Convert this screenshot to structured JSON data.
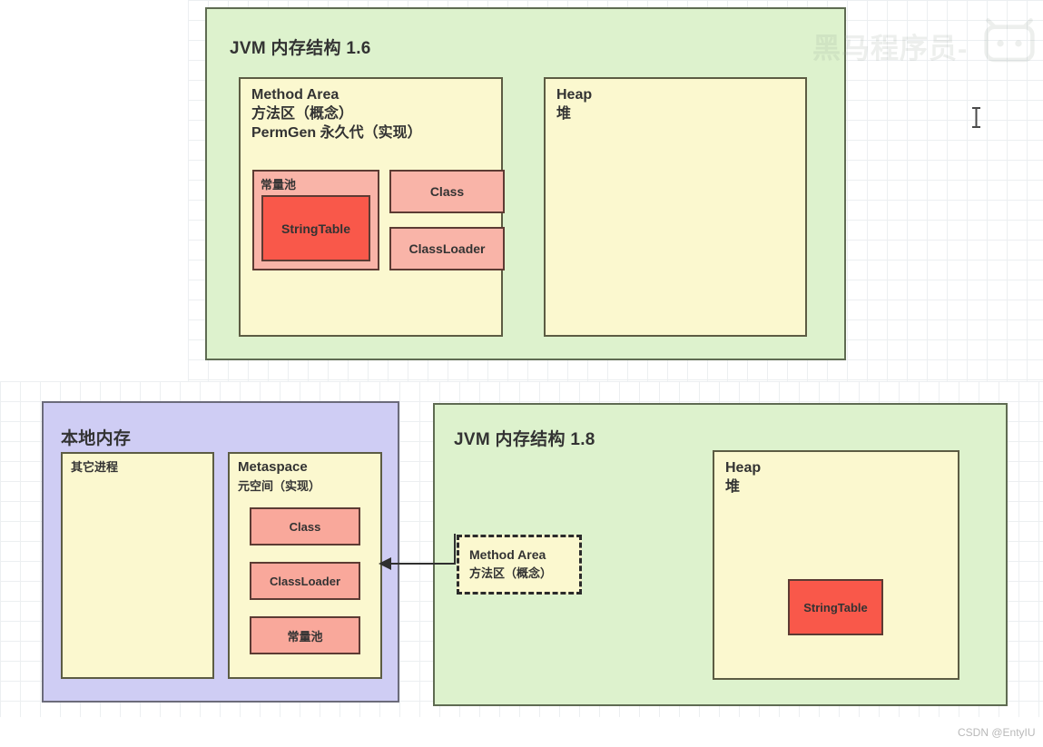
{
  "background": {
    "grid_color": "#eceff1",
    "page_color": "#ffffff"
  },
  "colors": {
    "panel_green": "#ddf2cd",
    "panel_purple": "#cfcdf4",
    "box_yellow": "#fbf8cf",
    "box_salmon": "#f9a89b",
    "box_salmon_light": "#f9b4a8",
    "box_red": "#f9584a",
    "border_dark": "#5c5c43",
    "arrow": "#2f2f2f"
  },
  "jvm16_panel": {
    "title": "JVM 内存结构 1.6",
    "method_area": {
      "line1": "Method Area",
      "line2": "方法区（概念）",
      "line3": "PermGen 永久代（实现）",
      "constant_pool": {
        "label": "常量池",
        "string_table": "StringTable"
      },
      "class_box": "Class",
      "classloader_box": "ClassLoader"
    },
    "heap": {
      "line1": "Heap",
      "line2": "堆"
    }
  },
  "native_memory_panel": {
    "title": "本地内存",
    "other_process": "其它进程",
    "metaspace": {
      "line1": "Metaspace",
      "line2": "元空间（实现）",
      "items": [
        "Class",
        "ClassLoader",
        "常量池"
      ]
    }
  },
  "jvm18_panel": {
    "title": "JVM 内存结构 1.8",
    "method_area_concept": {
      "line1": "Method Area",
      "line2": "方法区（概念）"
    },
    "heap": {
      "line1": "Heap",
      "line2": "堆",
      "string_table": "StringTable"
    }
  },
  "watermark": {
    "text": "黑马程序员-",
    "logo_name": "bilibili-logo-icon"
  },
  "credit": {
    "text": "CSDN @EntyIU"
  },
  "cursor": {
    "name": "text-caret-icon"
  }
}
